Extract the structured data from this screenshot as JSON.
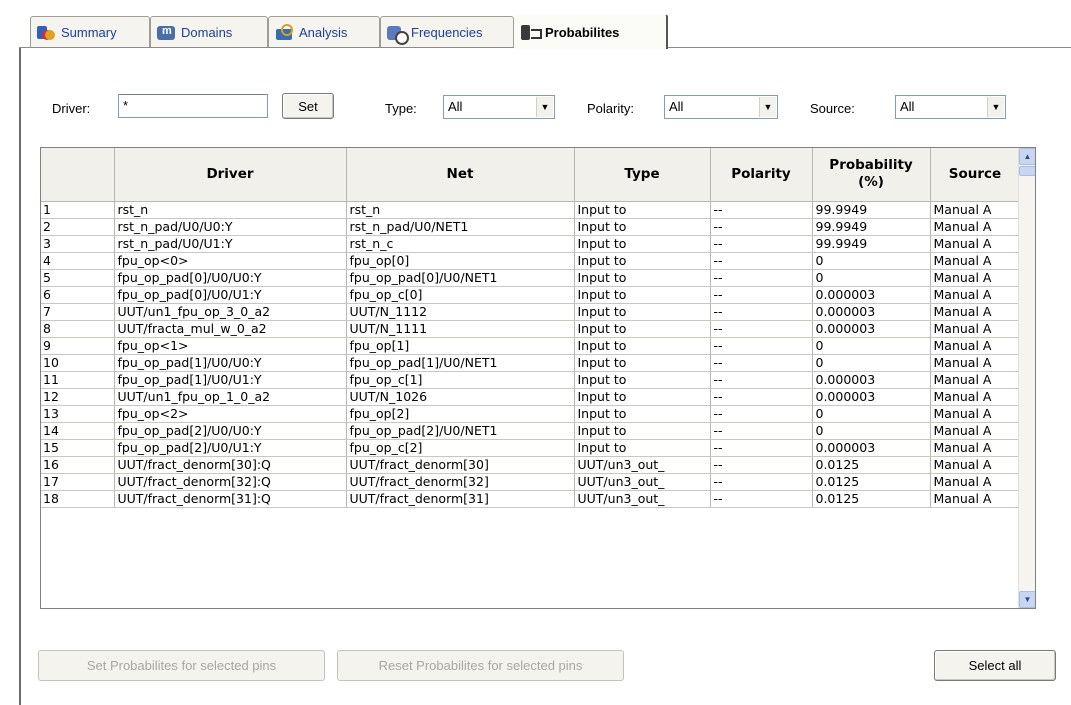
{
  "tabs": [
    {
      "label": "Summary",
      "icon": "summary-icon"
    },
    {
      "label": "Domains",
      "icon": "domains-icon"
    },
    {
      "label": "Analysis",
      "icon": "analysis-icon"
    },
    {
      "label": "Frequencies",
      "icon": "frequencies-icon"
    },
    {
      "label": "Probabilites",
      "icon": "probabilities-icon",
      "active": true
    }
  ],
  "filters": {
    "driver_label": "Driver:",
    "driver_value": "*",
    "set_label": "Set",
    "type_label": "Type:",
    "type_value": "All",
    "polarity_label": "Polarity:",
    "polarity_value": "All",
    "source_label": "Source:",
    "source_value": "All"
  },
  "grid": {
    "columns": [
      "",
      "Driver",
      "Net",
      "Type",
      "Polarity",
      "Probability (%)",
      "Source"
    ],
    "rows": [
      [
        "1",
        "rst_n",
        "rst_n",
        "Input to",
        "--",
        "99.9949",
        "Manual A"
      ],
      [
        "2",
        "rst_n_pad/U0/U0:Y",
        "rst_n_pad/U0/NET1",
        "Input to",
        "--",
        "99.9949",
        "Manual A"
      ],
      [
        "3",
        "rst_n_pad/U0/U1:Y",
        "rst_n_c",
        "Input to",
        "--",
        "99.9949",
        "Manual A"
      ],
      [
        "4",
        "fpu_op<0>",
        "fpu_op[0]",
        "Input to",
        "--",
        "0",
        "Manual A"
      ],
      [
        "5",
        "fpu_op_pad[0]/U0/U0:Y",
        "fpu_op_pad[0]/U0/NET1",
        "Input to",
        "--",
        "0",
        "Manual A"
      ],
      [
        "6",
        "fpu_op_pad[0]/U0/U1:Y",
        "fpu_op_c[0]",
        "Input to",
        "--",
        "0.000003",
        "Manual A"
      ],
      [
        "7",
        "UUT/un1_fpu_op_3_0_a2",
        "UUT/N_1112",
        "Input to",
        "--",
        "0.000003",
        "Manual A"
      ],
      [
        "8",
        "UUT/fracta_mul_w_0_a2",
        "UUT/N_1111",
        "Input to",
        "--",
        "0.000003",
        "Manual A"
      ],
      [
        "9",
        "fpu_op<1>",
        "fpu_op[1]",
        "Input to",
        "--",
        "0",
        "Manual A"
      ],
      [
        "10",
        "fpu_op_pad[1]/U0/U0:Y",
        "fpu_op_pad[1]/U0/NET1",
        "Input to",
        "--",
        "0",
        "Manual A"
      ],
      [
        "11",
        "fpu_op_pad[1]/U0/U1:Y",
        "fpu_op_c[1]",
        "Input to",
        "--",
        "0.000003",
        "Manual A"
      ],
      [
        "12",
        "UUT/un1_fpu_op_1_0_a2",
        "UUT/N_1026",
        "Input to",
        "--",
        "0.000003",
        "Manual A"
      ],
      [
        "13",
        "fpu_op<2>",
        "fpu_op[2]",
        "Input to",
        "--",
        "0",
        "Manual A"
      ],
      [
        "14",
        "fpu_op_pad[2]/U0/U0:Y",
        "fpu_op_pad[2]/U0/NET1",
        "Input to",
        "--",
        "0",
        "Manual A"
      ],
      [
        "15",
        "fpu_op_pad[2]/U0/U1:Y",
        "fpu_op_c[2]",
        "Input to",
        "--",
        "0.000003",
        "Manual A"
      ],
      [
        "16",
        "UUT/fract_denorm[30]:Q",
        "UUT/fract_denorm[30]",
        "UUT/un3_out_",
        "--",
        "0.0125",
        "Manual A"
      ],
      [
        "17",
        "UUT/fract_denorm[32]:Q",
        "UUT/fract_denorm[32]",
        "UUT/un3_out_",
        "--",
        "0.0125",
        "Manual A"
      ],
      [
        "18",
        "UUT/fract_denorm[31]:Q",
        "UUT/fract_denorm[31]",
        "UUT/un3_out_",
        "--",
        "0.0125",
        "Manual A"
      ]
    ]
  },
  "actions": {
    "set_selected": "Set Probabilites for selected pins",
    "reset_selected": "Reset Probabilites for selected pins",
    "select_all": "Select all"
  }
}
